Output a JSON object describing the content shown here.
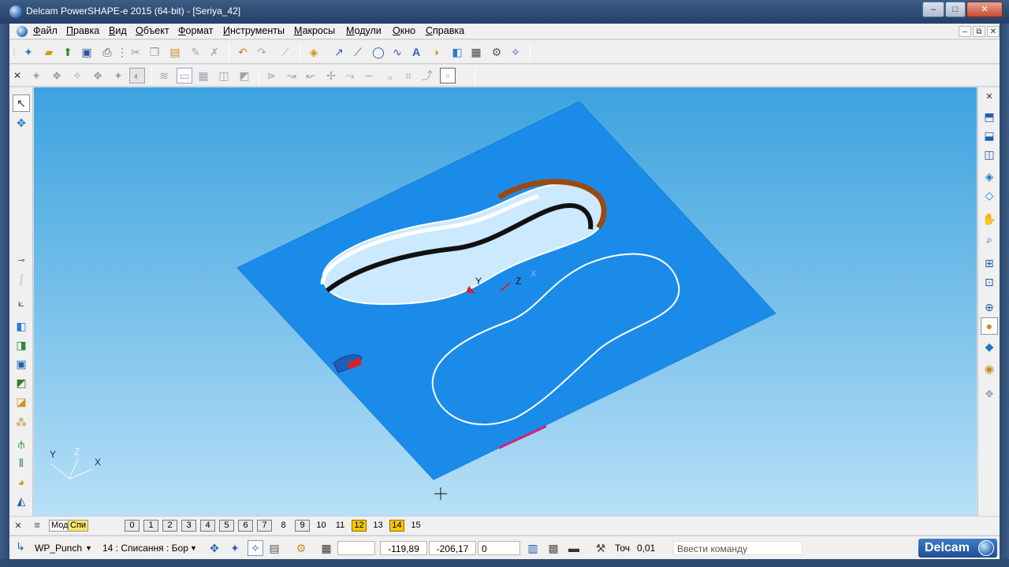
{
  "window": {
    "title": "Delcam PowerSHAPE-e 2015 (64-bit) - [Seriya_42]",
    "minimize": "–",
    "maximize": "□",
    "close": "✕"
  },
  "menu": {
    "items": [
      {
        "underline": "Ф",
        "rest": "айл"
      },
      {
        "underline": "П",
        "rest": "равка"
      },
      {
        "underline": "В",
        "rest": "ид"
      },
      {
        "underline": "О",
        "rest": "бъект"
      },
      {
        "underline": "Ф",
        "rest": "ормат"
      },
      {
        "underline": "И",
        "rest": "нструменты"
      },
      {
        "underline": "М",
        "rest": "акросы"
      },
      {
        "underline": "М",
        "rest": "одули"
      },
      {
        "underline": "О",
        "rest": "кно"
      },
      {
        "underline": "С",
        "rest": "правка"
      }
    ],
    "doc_min": "–",
    "doc_restore": "⧉",
    "doc_close": "✕"
  },
  "viewport": {
    "axis_labels": {
      "y": "Y",
      "z": "Z",
      "x": "X"
    },
    "workplane_labels": {
      "y": "Y",
      "z": "Z",
      "x": "X"
    }
  },
  "levels": {
    "tabs": [
      "Мод",
      "Спи"
    ],
    "items": [
      {
        "n": "0",
        "style": "box"
      },
      {
        "n": "1",
        "style": "box"
      },
      {
        "n": "2",
        "style": "box"
      },
      {
        "n": "3",
        "style": "box"
      },
      {
        "n": "4",
        "style": "box"
      },
      {
        "n": "5",
        "style": "box"
      },
      {
        "n": "6",
        "style": "box"
      },
      {
        "n": "7",
        "style": "box"
      },
      {
        "n": "8",
        "style": "plain"
      },
      {
        "n": "9",
        "style": "box"
      },
      {
        "n": "10",
        "style": "plain"
      },
      {
        "n": "11",
        "style": "plain"
      },
      {
        "n": "12",
        "style": "on"
      },
      {
        "n": "13",
        "style": "plain"
      },
      {
        "n": "14",
        "style": "on"
      },
      {
        "n": "15",
        "style": "plain"
      }
    ]
  },
  "status": {
    "workplane": "WP_Punch",
    "level_select": "14 : Списання : Бор",
    "coord_x": "-119,89",
    "coord_y": "-206,17",
    "coord_z": "0",
    "tolerance_label": "Точ",
    "tolerance_value": "0,01",
    "command_placeholder": "Ввести команду",
    "brand": "Delcam"
  }
}
